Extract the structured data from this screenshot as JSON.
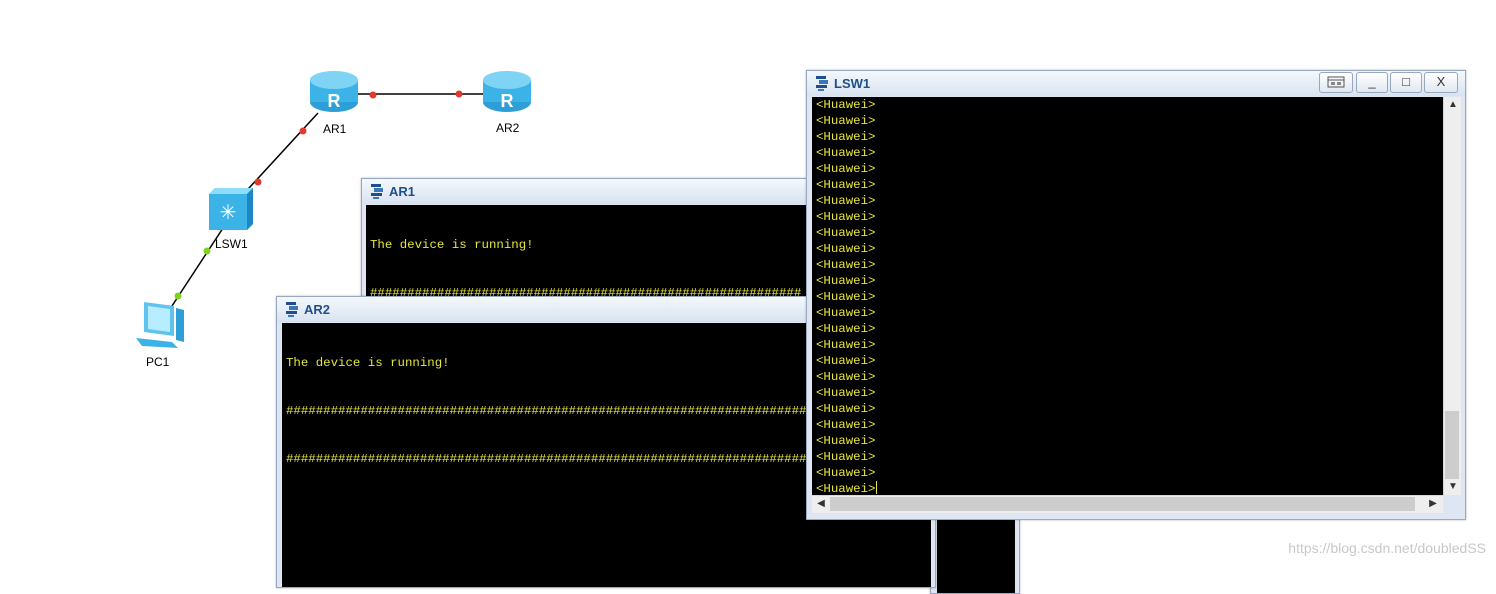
{
  "topology": {
    "devices": [
      {
        "id": "AR1",
        "label": "AR1",
        "type": "router-icon"
      },
      {
        "id": "AR2",
        "label": "AR2",
        "type": "router-icon"
      },
      {
        "id": "LSW1",
        "label": "LSW1",
        "type": "switch-icon"
      },
      {
        "id": "PC1",
        "label": "PC1",
        "type": "pc-icon"
      }
    ],
    "link_colors": {
      "red_port": "#e03a2e",
      "green_port": "#7ed321"
    }
  },
  "windows": {
    "ar1": {
      "title": "AR1",
      "lines": [
        "The device is running!",
        "##########################################################",
        "##########################################################"
      ]
    },
    "ar2": {
      "title": "AR2",
      "lines": [
        "The device is running!",
        "##########################################################################",
        "##########################################################################"
      ]
    },
    "lsw1": {
      "title": "LSW1",
      "buttons": {
        "restore_icon": "restore-icon",
        "minimize": "_",
        "maximize": "□",
        "close": "X"
      },
      "prompt": "<Huawei>",
      "prompt_count": 24
    }
  },
  "watermark": "https://blog.csdn.net/doubledSS",
  "colors": {
    "terminal_bg": "#000000",
    "terminal_text": "#e6e63c",
    "title_text": "#1f4f8a"
  }
}
